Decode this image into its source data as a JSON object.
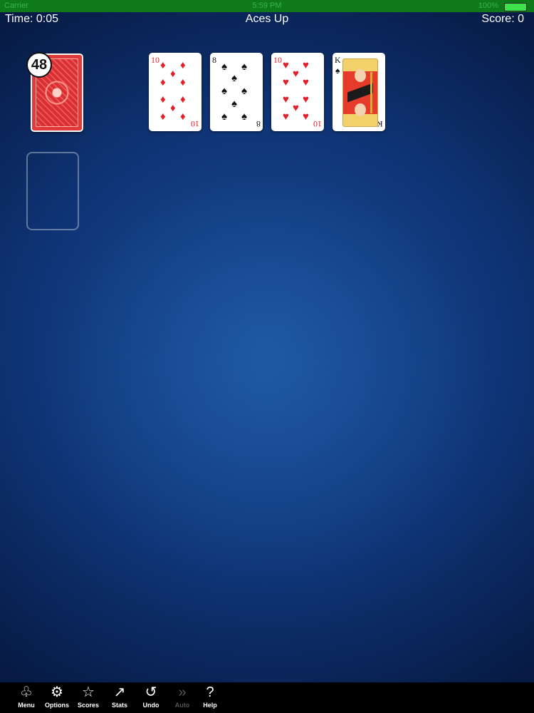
{
  "status_bar": {
    "carrier": "Carrier",
    "clock": "5:59 PM",
    "battery": "100%"
  },
  "hud": {
    "time": "Time: 0:05",
    "title": "Aces Up",
    "score": "Score: 0"
  },
  "stock": {
    "count": "48"
  },
  "tableau": [
    {
      "rank": "10",
      "suit": "diamonds",
      "symbol": "♦",
      "color": "red"
    },
    {
      "rank": "8",
      "suit": "spades",
      "symbol": "♠",
      "color": "black"
    },
    {
      "rank": "10",
      "suit": "hearts",
      "symbol": "♥",
      "color": "red"
    },
    {
      "rank": "K",
      "suit": "spades",
      "symbol": "♠",
      "color": "black"
    }
  ],
  "toolbar": {
    "menu": {
      "label": "Menu",
      "icon": "card-suits-icon"
    },
    "options": {
      "label": "Options",
      "icon": "gears-icon"
    },
    "scores": {
      "label": "Scores",
      "icon": "star-icon"
    },
    "stats": {
      "label": "Stats",
      "icon": "chart-icon"
    },
    "undo": {
      "label": "Undo",
      "icon": "undo-icon"
    },
    "auto": {
      "label": "Auto",
      "icon": "fast-forward-icon"
    },
    "help": {
      "label": "Help",
      "icon": "question-icon"
    }
  },
  "colors": {
    "felt": "#0f3577",
    "card_red": "#e3202a",
    "card_back": "#e03a3a",
    "status_bar": "#0e7a1a"
  }
}
